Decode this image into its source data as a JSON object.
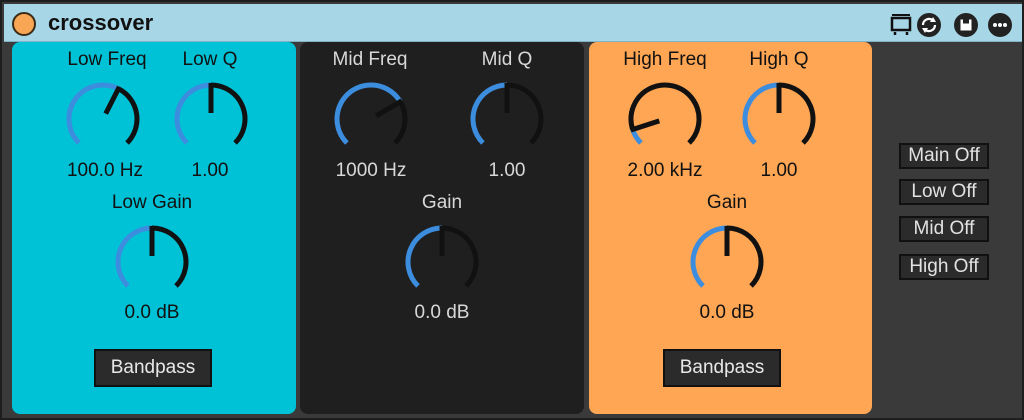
{
  "device": {
    "title": "crossover"
  },
  "titlebar_icons": [
    "midi-map-icon",
    "sync-icon",
    "save-icon",
    "more-icon"
  ],
  "colors": {
    "low": "#00c2d6",
    "mid": "#1f1f1f",
    "high": "#ffa654",
    "accent": "#3d8ddf"
  },
  "low": {
    "freq_label": "Low Freq",
    "freq_value": "100.0 Hz",
    "q_label": "Low Q",
    "q_value": "1.00",
    "gain_label": "Low Gain",
    "gain_value": "0.0 dB",
    "mode_button": "Bandpass"
  },
  "mid": {
    "freq_label": "Mid Freq",
    "freq_value": "1000 Hz",
    "q_label": "Mid Q",
    "q_value": "1.00",
    "gain_label": "Gain",
    "gain_value": "0.0 dB"
  },
  "high": {
    "freq_label": "High Freq",
    "freq_value": "2.00 kHz",
    "q_label": "High Q",
    "q_value": "1.00",
    "gain_label": "Gain",
    "gain_value": "0.0 dB",
    "mode_button": "Bandpass"
  },
  "knob_levels": {
    "low_freq": 0.6,
    "low_q": 0.5,
    "low_gain": 0.5,
    "mid_freq": 0.72,
    "mid_q": 0.5,
    "mid_gain": 0.5,
    "high_freq": 0.1,
    "high_q": 0.5,
    "high_gain": 0.5
  },
  "toggles": {
    "main": "Main Off",
    "low": "Low Off",
    "mid": "Mid Off",
    "high": "High Off"
  }
}
